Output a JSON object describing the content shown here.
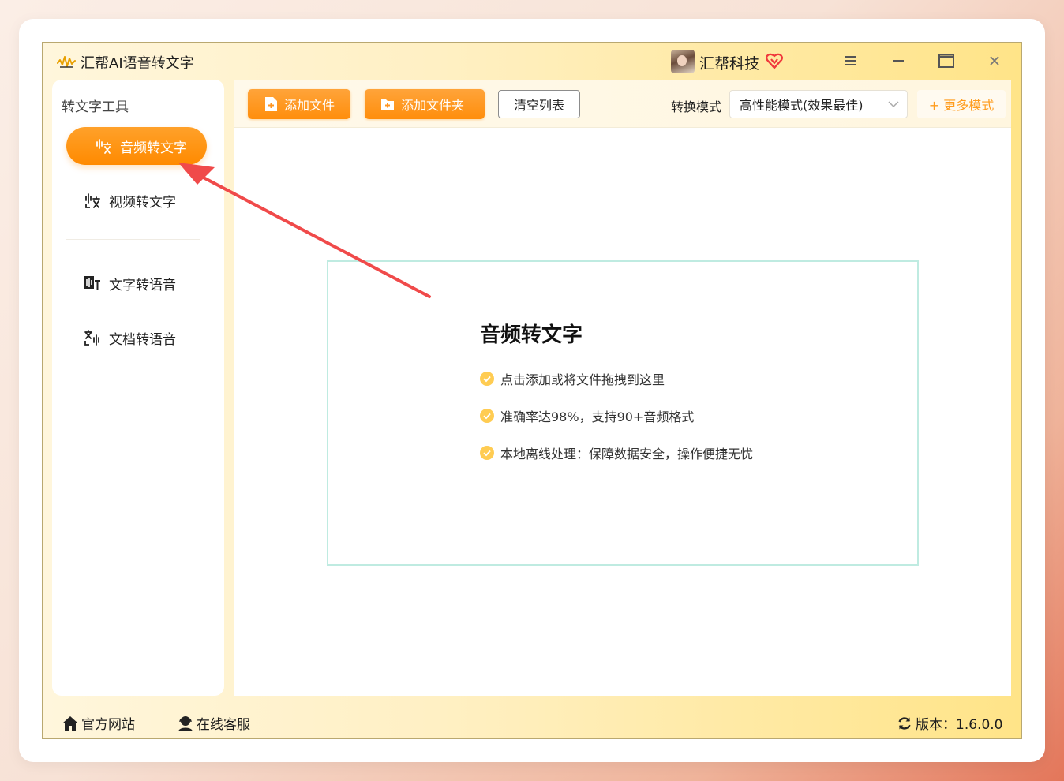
{
  "app": {
    "title": "汇帮AI语音转文字",
    "user_name": "汇帮科技",
    "icons": {
      "logo": "waveform-logo-icon",
      "vip": "vip-heart-icon",
      "menu": "hamburger-menu-icon",
      "minimize": "minimize-icon",
      "maximize": "maximize-icon",
      "close": "close-icon"
    }
  },
  "sidebar": {
    "heading": "转文字工具",
    "items": [
      {
        "label": "音频转文字",
        "icon": "audio-to-text-icon",
        "active": true
      },
      {
        "label": "视频转文字",
        "icon": "video-to-text-icon",
        "active": false
      },
      {
        "label": "文字转语音",
        "icon": "text-to-speech-icon",
        "active": false
      },
      {
        "label": "文档转语音",
        "icon": "document-to-speech-icon",
        "active": false
      }
    ]
  },
  "toolbar": {
    "add_file": "添加文件",
    "add_folder": "添加文件夹",
    "clear_list": "清空列表",
    "mode_label": "转换模式",
    "mode_value": "高性能模式(效果最佳)",
    "more_modes": "+ 更多模式"
  },
  "drop_zone": {
    "title": "音频转文字",
    "features": [
      "点击添加或将文件拖拽到这里",
      "准确率达98%，支持90+音频格式",
      "本地离线处理：保障数据安全，操作便捷无忧"
    ]
  },
  "statusbar": {
    "site": "官方网站",
    "service": "在线客服",
    "version": "版本：1.6.0.0"
  },
  "colors": {
    "accent": "#ff8e0c",
    "check": "#ffc94a",
    "drop_border": "#bfebe1",
    "arrow": "#f04a4a"
  }
}
